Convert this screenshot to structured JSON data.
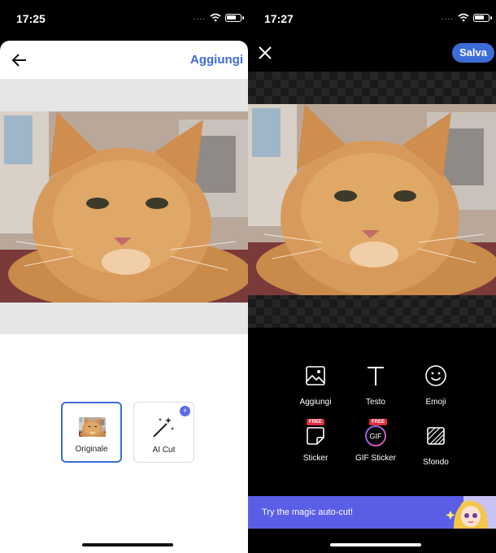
{
  "left": {
    "status_time": "17:25",
    "nav": {
      "action_label": "Aggiungi"
    },
    "options": [
      {
        "label": "Originale",
        "selected": true
      },
      {
        "label": "AI Cut",
        "selected": false,
        "badge": "+"
      }
    ]
  },
  "right": {
    "status_time": "17:27",
    "save_label": "Salva",
    "tools": [
      {
        "label": "Aggiungi",
        "icon": "image-icon"
      },
      {
        "label": "Testo",
        "icon": "text-icon"
      },
      {
        "label": "Emoji",
        "icon": "smiley-icon"
      },
      {
        "label": "Sticker",
        "icon": "sticker-icon",
        "badge": "FREE"
      },
      {
        "label": "GIF Sticker",
        "icon": "gif-icon",
        "badge": "FREE",
        "icon_text": "GIF"
      },
      {
        "label": "Sfondo",
        "icon": "background-icon"
      }
    ],
    "banner_text": "Try the magic auto-cut!"
  },
  "colors": {
    "accent": "#3c6cd7",
    "banner": "#5a5ee6",
    "free_badge": "#e22b3b"
  }
}
